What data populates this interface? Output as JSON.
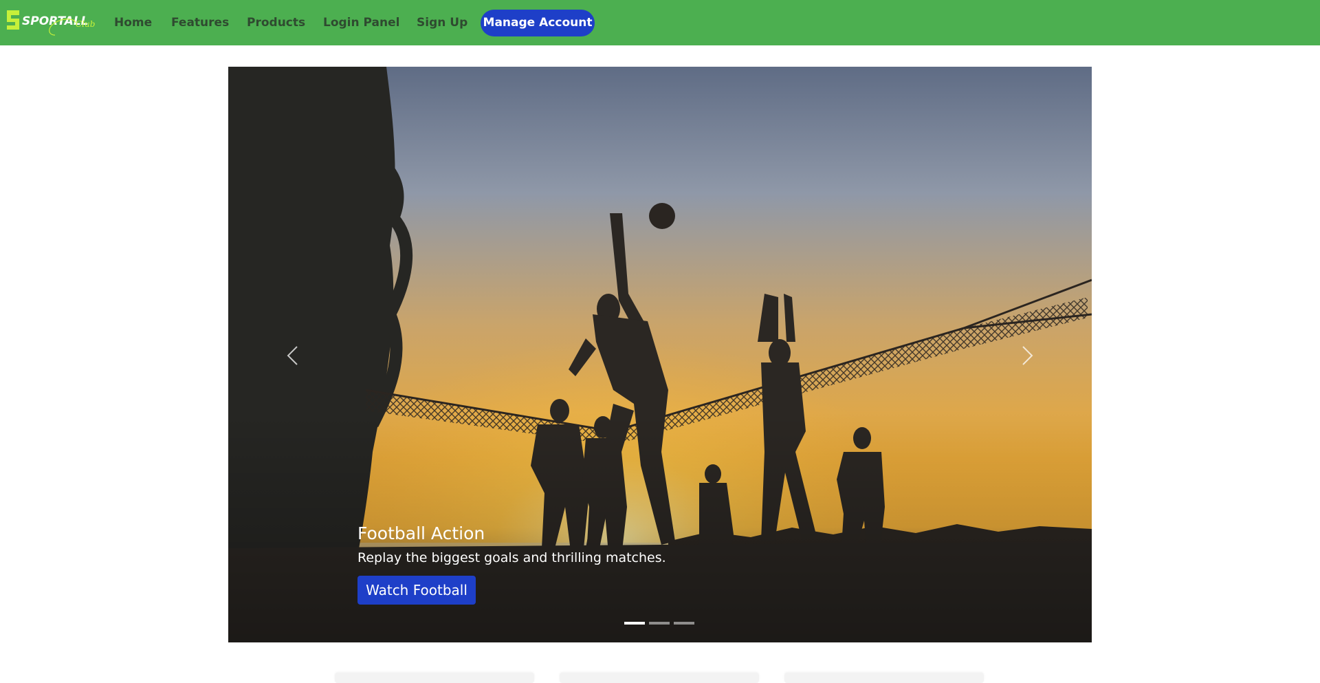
{
  "brand": {
    "logo_text": "SPORTALL",
    "logo_script": "Club"
  },
  "nav": {
    "home": "Home",
    "features": "Features",
    "products": "Products",
    "login": "Login Panel",
    "signup": "Sign Up",
    "manage": "Manage Account"
  },
  "carousel": {
    "active_slide": 1,
    "slide_count": 3,
    "slide": {
      "title": "Football Action",
      "text": "Replay the biggest goals and thrilling matches.",
      "button": "Watch Football"
    }
  },
  "colors": {
    "navbar": "#4caf50",
    "nav_text": "#2f4a30",
    "accent_button": "#1e3fc8",
    "logo_green": "#c6f03a"
  },
  "icons": {
    "prev": "chevron-left-icon",
    "next": "chevron-right-icon"
  }
}
